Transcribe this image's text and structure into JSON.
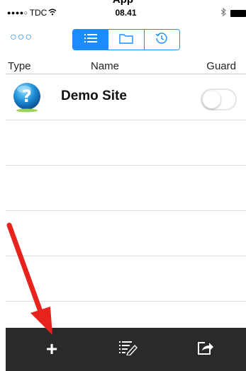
{
  "caption": {
    "text": "App"
  },
  "status_bar": {
    "signal_dots": "●●●●○",
    "carrier": "TDC",
    "wifi_icon": "wifi-icon",
    "time": "08.41",
    "bluetooth_icon": "bluetooth-icon",
    "battery_icon": "battery-icon"
  },
  "navbar": {
    "more_label": "○○○",
    "segments": [
      {
        "icon": "list-icon",
        "active": true
      },
      {
        "icon": "folder-icon",
        "active": false
      },
      {
        "icon": "history-icon",
        "active": false
      }
    ]
  },
  "columns": {
    "type": "Type",
    "name": "Name",
    "guard": "Guard"
  },
  "sites": [
    {
      "icon": "help-question-icon",
      "name": "Demo Site",
      "guard_enabled": false
    }
  ],
  "toolbar": {
    "add_label": "+",
    "edit_icon": "edit-list-icon",
    "share_icon": "share-icon"
  },
  "colors": {
    "accent": "#1a8cff",
    "toolbar_bg": "#2a2a2a",
    "arrow": "#e8231e"
  }
}
